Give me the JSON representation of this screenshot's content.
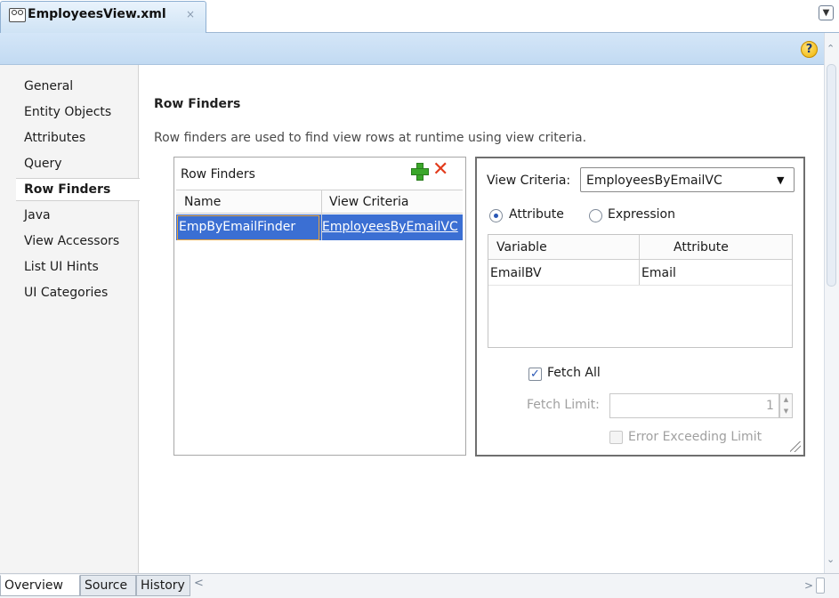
{
  "editor": {
    "file_tab": "EmployeesView.xml",
    "close_glyph": "×",
    "menu_glyph": "▼",
    "help_glyph": "?"
  },
  "nav": {
    "items": [
      "General",
      "Entity Objects",
      "Attributes",
      "Query",
      "Row Finders",
      "Java",
      "View Accessors",
      "List UI Hints",
      "UI Categories"
    ],
    "selected": "Row Finders"
  },
  "page": {
    "title": "Row Finders",
    "description": "Row finders are used to find view rows at runtime using view criteria."
  },
  "row_finders": {
    "panel_title": "Row Finders",
    "columns": [
      "Name",
      "View Criteria"
    ],
    "rows": [
      {
        "name": "EmpByEmailFinder",
        "view_criteria": "EmployeesByEmailVC"
      }
    ]
  },
  "view_criteria": {
    "label": "View Criteria:",
    "selected": "EmployeesByEmailVC",
    "radio_attribute": "Attribute",
    "radio_expression": "Expression",
    "radio_selected": "Attribute",
    "columns": [
      "Variable",
      "Attribute"
    ],
    "rows": [
      {
        "variable": "EmailBV",
        "attribute": "Email"
      }
    ],
    "fetch_all_label": "Fetch All",
    "fetch_all_checked": true,
    "fetch_limit_label": "Fetch Limit:",
    "fetch_limit_value": "1",
    "error_exceeding_label": "Error Exceeding Limit",
    "error_exceeding_checked": false
  },
  "bottom_tabs": [
    "Overview",
    "Source",
    "History"
  ],
  "active_bottom_tab": "Overview",
  "colors": {
    "selection_blue": "#3b6fd3",
    "header_blue": "#c2daf2",
    "add_green": "#3aa72a",
    "delete_red": "#e23b1c"
  }
}
